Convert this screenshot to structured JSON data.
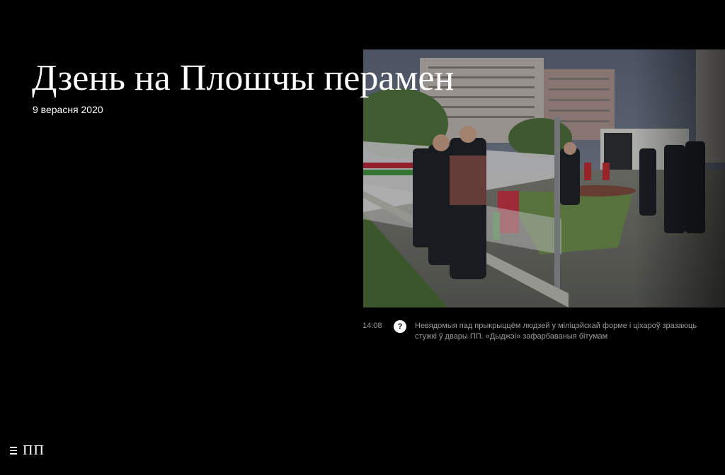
{
  "article": {
    "title": "Дзень на Плошчы перамен",
    "date": "9 верасня 2020"
  },
  "photo": {
    "time": "14:08",
    "icon": "question-icon",
    "icon_glyph": "?",
    "caption": "Невядомыя пад прыкрыццём людзей у міліцэйскай форме і ціхароў зразаюць стужкі ў двары ПП. «Дыджэі» зафарбаваныя бітумам"
  },
  "nav": {
    "menu_icon": "hamburger-menu-icon",
    "logo": "ПП"
  },
  "colors": {
    "background": "#000000",
    "text": "#ffffff",
    "muted": "#9a9a9a"
  }
}
